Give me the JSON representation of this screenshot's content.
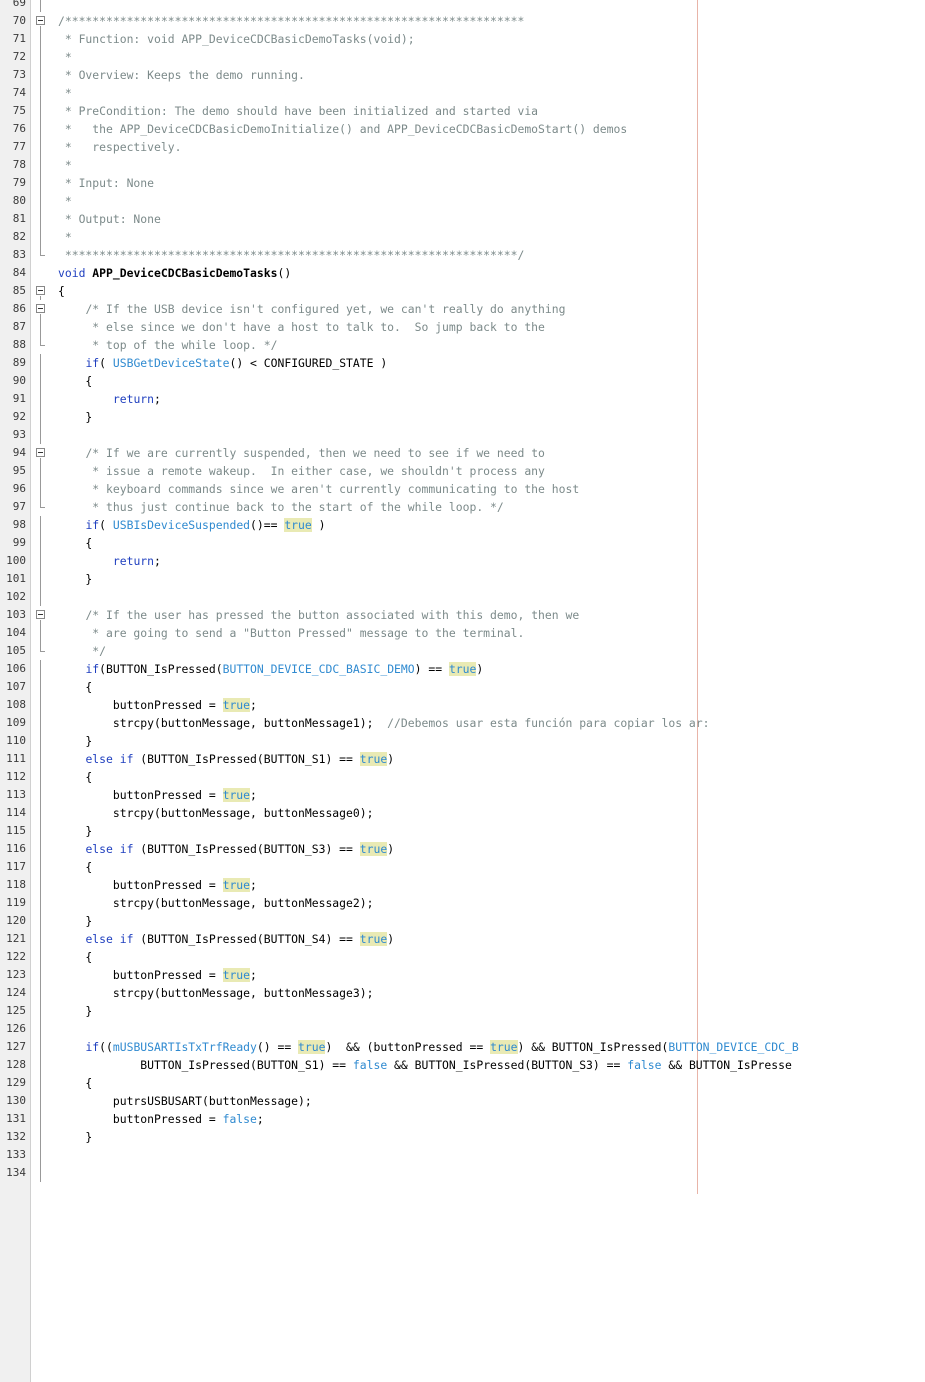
{
  "editor": {
    "lines": [
      {
        "n": "69",
        "fold": "line",
        "segs": []
      },
      {
        "n": "70",
        "fold": "box",
        "segs": [
          {
            "s": "c",
            "t": "/*******************************************************************"
          }
        ]
      },
      {
        "n": "71",
        "fold": "line",
        "segs": [
          {
            "s": "c",
            "t": " * Function: void APP_DeviceCDCBasicDemoTasks(void);"
          }
        ]
      },
      {
        "n": "72",
        "fold": "line",
        "segs": [
          {
            "s": "c",
            "t": " *"
          }
        ]
      },
      {
        "n": "73",
        "fold": "line",
        "segs": [
          {
            "s": "c",
            "t": " * Overview: Keeps the demo running."
          }
        ]
      },
      {
        "n": "74",
        "fold": "line",
        "segs": [
          {
            "s": "c",
            "t": " *"
          }
        ]
      },
      {
        "n": "75",
        "fold": "line",
        "segs": [
          {
            "s": "c",
            "t": " * PreCondition: The demo should have been initialized and started via"
          }
        ]
      },
      {
        "n": "76",
        "fold": "line",
        "segs": [
          {
            "s": "c",
            "t": " *   the APP_DeviceCDCBasicDemoInitialize() and APP_DeviceCDCBasicDemoStart() demos"
          }
        ]
      },
      {
        "n": "77",
        "fold": "line",
        "segs": [
          {
            "s": "c",
            "t": " *   respectively."
          }
        ]
      },
      {
        "n": "78",
        "fold": "line",
        "segs": [
          {
            "s": "c",
            "t": " *"
          }
        ]
      },
      {
        "n": "79",
        "fold": "line",
        "segs": [
          {
            "s": "c",
            "t": " * Input: None"
          }
        ]
      },
      {
        "n": "80",
        "fold": "line",
        "segs": [
          {
            "s": "c",
            "t": " *"
          }
        ]
      },
      {
        "n": "81",
        "fold": "line",
        "segs": [
          {
            "s": "c",
            "t": " * Output: None"
          }
        ]
      },
      {
        "n": "82",
        "fold": "line",
        "segs": [
          {
            "s": "c",
            "t": " *"
          }
        ]
      },
      {
        "n": "83",
        "fold": "end",
        "segs": [
          {
            "s": "c",
            "t": " ******************************************************************/"
          }
        ]
      },
      {
        "n": "84",
        "fold": "",
        "segs": [
          {
            "s": "k",
            "t": "void"
          },
          {
            "s": "",
            "t": " "
          },
          {
            "s": "b",
            "t": "APP_DeviceCDCBasicDemoTasks"
          },
          {
            "s": "",
            "t": "()"
          }
        ]
      },
      {
        "n": "85",
        "fold": "box",
        "segs": [
          {
            "s": "",
            "t": "{"
          }
        ]
      },
      {
        "n": "86",
        "fold": "box",
        "segs": [
          {
            "s": "",
            "t": "    "
          },
          {
            "s": "c",
            "t": "/* If the USB device isn't configured yet, we can't really do anything"
          }
        ]
      },
      {
        "n": "87",
        "fold": "line",
        "segs": [
          {
            "s": "c",
            "t": "     * else since we don't have a host to talk to.  So jump back to the"
          }
        ]
      },
      {
        "n": "88",
        "fold": "end",
        "segs": [
          {
            "s": "c",
            "t": "     * top of the while loop. */"
          }
        ]
      },
      {
        "n": "89",
        "fold": "line",
        "segs": [
          {
            "s": "",
            "t": "    "
          },
          {
            "s": "k",
            "t": "if"
          },
          {
            "s": "",
            "t": "( "
          },
          {
            "s": "f",
            "t": "USBGetDeviceState"
          },
          {
            "s": "",
            "t": "() < CONFIGURED_STATE )"
          }
        ]
      },
      {
        "n": "90",
        "fold": "line",
        "segs": [
          {
            "s": "",
            "t": "    {"
          }
        ]
      },
      {
        "n": "91",
        "fold": "line",
        "segs": [
          {
            "s": "",
            "t": "        "
          },
          {
            "s": "k",
            "t": "return"
          },
          {
            "s": "",
            "t": ";"
          }
        ]
      },
      {
        "n": "92",
        "fold": "line",
        "segs": [
          {
            "s": "",
            "t": "    }"
          }
        ]
      },
      {
        "n": "93",
        "fold": "line",
        "segs": []
      },
      {
        "n": "94",
        "fold": "box",
        "segs": [
          {
            "s": "",
            "t": "    "
          },
          {
            "s": "c",
            "t": "/* If we are currently suspended, then we need to see if we need to"
          }
        ]
      },
      {
        "n": "95",
        "fold": "line",
        "segs": [
          {
            "s": "c",
            "t": "     * issue a remote wakeup.  In either case, we shouldn't process any"
          }
        ]
      },
      {
        "n": "96",
        "fold": "line",
        "segs": [
          {
            "s": "c",
            "t": "     * keyboard commands since we aren't currently communicating to the host"
          }
        ]
      },
      {
        "n": "97",
        "fold": "end",
        "segs": [
          {
            "s": "c",
            "t": "     * thus just continue back to the start of the while loop. */"
          }
        ]
      },
      {
        "n": "98",
        "fold": "line",
        "segs": [
          {
            "s": "",
            "t": "    "
          },
          {
            "s": "k",
            "t": "if"
          },
          {
            "s": "",
            "t": "( "
          },
          {
            "s": "f",
            "t": "USBIsDeviceSuspended"
          },
          {
            "s": "",
            "t": "()== "
          },
          {
            "s": "t",
            "t": "true"
          },
          {
            "s": "",
            "t": " )"
          }
        ]
      },
      {
        "n": "99",
        "fold": "line",
        "segs": [
          {
            "s": "",
            "t": "    {"
          }
        ]
      },
      {
        "n": "100",
        "fold": "line",
        "segs": [
          {
            "s": "",
            "t": "        "
          },
          {
            "s": "k",
            "t": "return"
          },
          {
            "s": "",
            "t": ";"
          }
        ]
      },
      {
        "n": "101",
        "fold": "line",
        "segs": [
          {
            "s": "",
            "t": "    }"
          }
        ]
      },
      {
        "n": "102",
        "fold": "line",
        "segs": []
      },
      {
        "n": "103",
        "fold": "box",
        "segs": [
          {
            "s": "",
            "t": "    "
          },
          {
            "s": "c",
            "t": "/* If the user has pressed the button associated with this demo, then we"
          }
        ]
      },
      {
        "n": "104",
        "fold": "line",
        "segs": [
          {
            "s": "c",
            "t": "     * are going to send a \"Button Pressed\" message to the terminal."
          }
        ]
      },
      {
        "n": "105",
        "fold": "end",
        "segs": [
          {
            "s": "c",
            "t": "     */"
          }
        ]
      },
      {
        "n": "106",
        "fold": "line",
        "segs": [
          {
            "s": "",
            "t": "    "
          },
          {
            "s": "k",
            "t": "if"
          },
          {
            "s": "",
            "t": "(BUTTON_IsPressed("
          },
          {
            "s": "f",
            "t": "BUTTON_DEVICE_CDC_BASIC_DEMO"
          },
          {
            "s": "",
            "t": ") == "
          },
          {
            "s": "t",
            "t": "true"
          },
          {
            "s": "",
            "t": ")"
          }
        ]
      },
      {
        "n": "107",
        "fold": "line",
        "segs": [
          {
            "s": "",
            "t": "    {"
          }
        ]
      },
      {
        "n": "108",
        "fold": "line",
        "segs": [
          {
            "s": "",
            "t": "        buttonPressed = "
          },
          {
            "s": "t",
            "t": "true"
          },
          {
            "s": "",
            "t": ";"
          }
        ]
      },
      {
        "n": "109",
        "fold": "line",
        "segs": [
          {
            "s": "",
            "t": "        strcpy(buttonMessage, buttonMessage1);  "
          },
          {
            "s": "c",
            "t": "//Debemos usar esta función para copiar los ar:"
          }
        ]
      },
      {
        "n": "110",
        "fold": "line",
        "segs": [
          {
            "s": "",
            "t": "    }"
          }
        ]
      },
      {
        "n": "111",
        "fold": "line",
        "segs": [
          {
            "s": "",
            "t": "    "
          },
          {
            "s": "k",
            "t": "else if"
          },
          {
            "s": "",
            "t": " (BUTTON_IsPressed(BUTTON_S1) == "
          },
          {
            "s": "t",
            "t": "true"
          },
          {
            "s": "",
            "t": ")"
          }
        ]
      },
      {
        "n": "112",
        "fold": "line",
        "segs": [
          {
            "s": "",
            "t": "    {"
          }
        ]
      },
      {
        "n": "113",
        "fold": "line",
        "segs": [
          {
            "s": "",
            "t": "        buttonPressed = "
          },
          {
            "s": "t",
            "t": "true"
          },
          {
            "s": "",
            "t": ";"
          }
        ]
      },
      {
        "n": "114",
        "fold": "line",
        "segs": [
          {
            "s": "",
            "t": "        strcpy(buttonMessage, buttonMessage0);"
          }
        ]
      },
      {
        "n": "115",
        "fold": "line",
        "segs": [
          {
            "s": "",
            "t": "    }"
          }
        ]
      },
      {
        "n": "116",
        "fold": "line",
        "segs": [
          {
            "s": "",
            "t": "    "
          },
          {
            "s": "k",
            "t": "else if"
          },
          {
            "s": "",
            "t": " (BUTTON_IsPressed(BUTTON_S3) == "
          },
          {
            "s": "t",
            "t": "true"
          },
          {
            "s": "",
            "t": ")"
          }
        ]
      },
      {
        "n": "117",
        "fold": "line",
        "segs": [
          {
            "s": "",
            "t": "    {"
          }
        ]
      },
      {
        "n": "118",
        "fold": "line",
        "segs": [
          {
            "s": "",
            "t": "        buttonPressed = "
          },
          {
            "s": "t",
            "t": "true"
          },
          {
            "s": "",
            "t": ";"
          }
        ]
      },
      {
        "n": "119",
        "fold": "line",
        "segs": [
          {
            "s": "",
            "t": "        strcpy(buttonMessage, buttonMessage2);"
          }
        ]
      },
      {
        "n": "120",
        "fold": "line",
        "segs": [
          {
            "s": "",
            "t": "    }"
          }
        ]
      },
      {
        "n": "121",
        "fold": "line",
        "segs": [
          {
            "s": "",
            "t": "    "
          },
          {
            "s": "k",
            "t": "else if"
          },
          {
            "s": "",
            "t": " (BUTTON_IsPressed(BUTTON_S4) == "
          },
          {
            "s": "t",
            "t": "true"
          },
          {
            "s": "",
            "t": ")"
          }
        ]
      },
      {
        "n": "122",
        "fold": "line",
        "segs": [
          {
            "s": "",
            "t": "    {"
          }
        ]
      },
      {
        "n": "123",
        "fold": "line",
        "segs": [
          {
            "s": "",
            "t": "        buttonPressed = "
          },
          {
            "s": "t",
            "t": "true"
          },
          {
            "s": "",
            "t": ";"
          }
        ]
      },
      {
        "n": "124",
        "fold": "line",
        "segs": [
          {
            "s": "",
            "t": "        strcpy(buttonMessage, buttonMessage3);"
          }
        ]
      },
      {
        "n": "125",
        "fold": "line",
        "segs": [
          {
            "s": "",
            "t": "    }"
          }
        ]
      },
      {
        "n": "126",
        "fold": "line",
        "segs": []
      },
      {
        "n": "127",
        "fold": "line",
        "segs": [
          {
            "s": "",
            "t": "    "
          },
          {
            "s": "k",
            "t": "if"
          },
          {
            "s": "",
            "t": "(("
          },
          {
            "s": "f",
            "t": "mUSBUSARTIsTxTrfReady"
          },
          {
            "s": "",
            "t": "() == "
          },
          {
            "s": "t",
            "t": "true"
          },
          {
            "s": "",
            "t": ")  && (buttonPressed == "
          },
          {
            "s": "t",
            "t": "true"
          },
          {
            "s": "",
            "t": ") && BUTTON_IsPressed("
          },
          {
            "s": "f",
            "t": "BUTTON_DEVICE_CDC_B"
          }
        ]
      },
      {
        "n": "128",
        "fold": "line",
        "segs": [
          {
            "s": "",
            "t": "            BUTTON_IsPressed(BUTTON_S1) == "
          },
          {
            "s": "f",
            "t": "false"
          },
          {
            "s": "",
            "t": " && BUTTON_IsPressed(BUTTON_S3) == "
          },
          {
            "s": "f",
            "t": "false"
          },
          {
            "s": "",
            "t": " && BUTTON_IsPresse"
          }
        ]
      },
      {
        "n": "129",
        "fold": "line",
        "segs": [
          {
            "s": "",
            "t": "    {"
          }
        ]
      },
      {
        "n": "130",
        "fold": "line",
        "segs": [
          {
            "s": "",
            "t": "        putrsUSBUSART(buttonMessage);"
          }
        ]
      },
      {
        "n": "131",
        "fold": "line",
        "segs": [
          {
            "s": "",
            "t": "        buttonPressed = "
          },
          {
            "s": "f",
            "t": "false"
          },
          {
            "s": "",
            "t": ";"
          }
        ]
      },
      {
        "n": "132",
        "fold": "line",
        "segs": [
          {
            "s": "",
            "t": "    }"
          }
        ]
      },
      {
        "n": "133",
        "fold": "line",
        "segs": []
      },
      {
        "n": "134",
        "fold": "line",
        "segs": []
      }
    ]
  }
}
